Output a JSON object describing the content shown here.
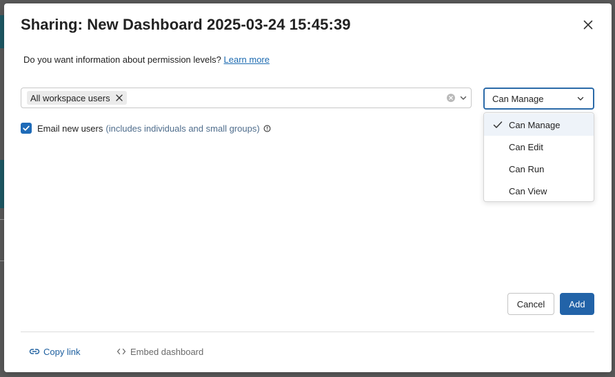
{
  "modal": {
    "title": "Sharing: New Dashboard 2025-03-24 15:45:39",
    "info_text": "Do you want information about permission levels?",
    "learn_more": "Learn more"
  },
  "share_with": {
    "tags": [
      "All workspace users"
    ]
  },
  "permission": {
    "selected": "Can Manage",
    "options": [
      "Can Manage",
      "Can Edit",
      "Can Run",
      "Can View"
    ]
  },
  "email": {
    "checked": true,
    "label": "Email new users",
    "hint": "(includes individuals and small groups)"
  },
  "actions": {
    "cancel": "Cancel",
    "add": "Add"
  },
  "footer": {
    "copy_link": "Copy link",
    "embed": "Embed dashboard"
  },
  "colors": {
    "primary": "#2263a8",
    "link": "#1d6bb1",
    "selected_option_bg": "#eef3f9"
  },
  "icons": [
    "close-icon",
    "tag-remove-icon",
    "clear-icon",
    "chevron-down-icon",
    "check-icon",
    "info-icon",
    "link-icon",
    "code-icon"
  ]
}
